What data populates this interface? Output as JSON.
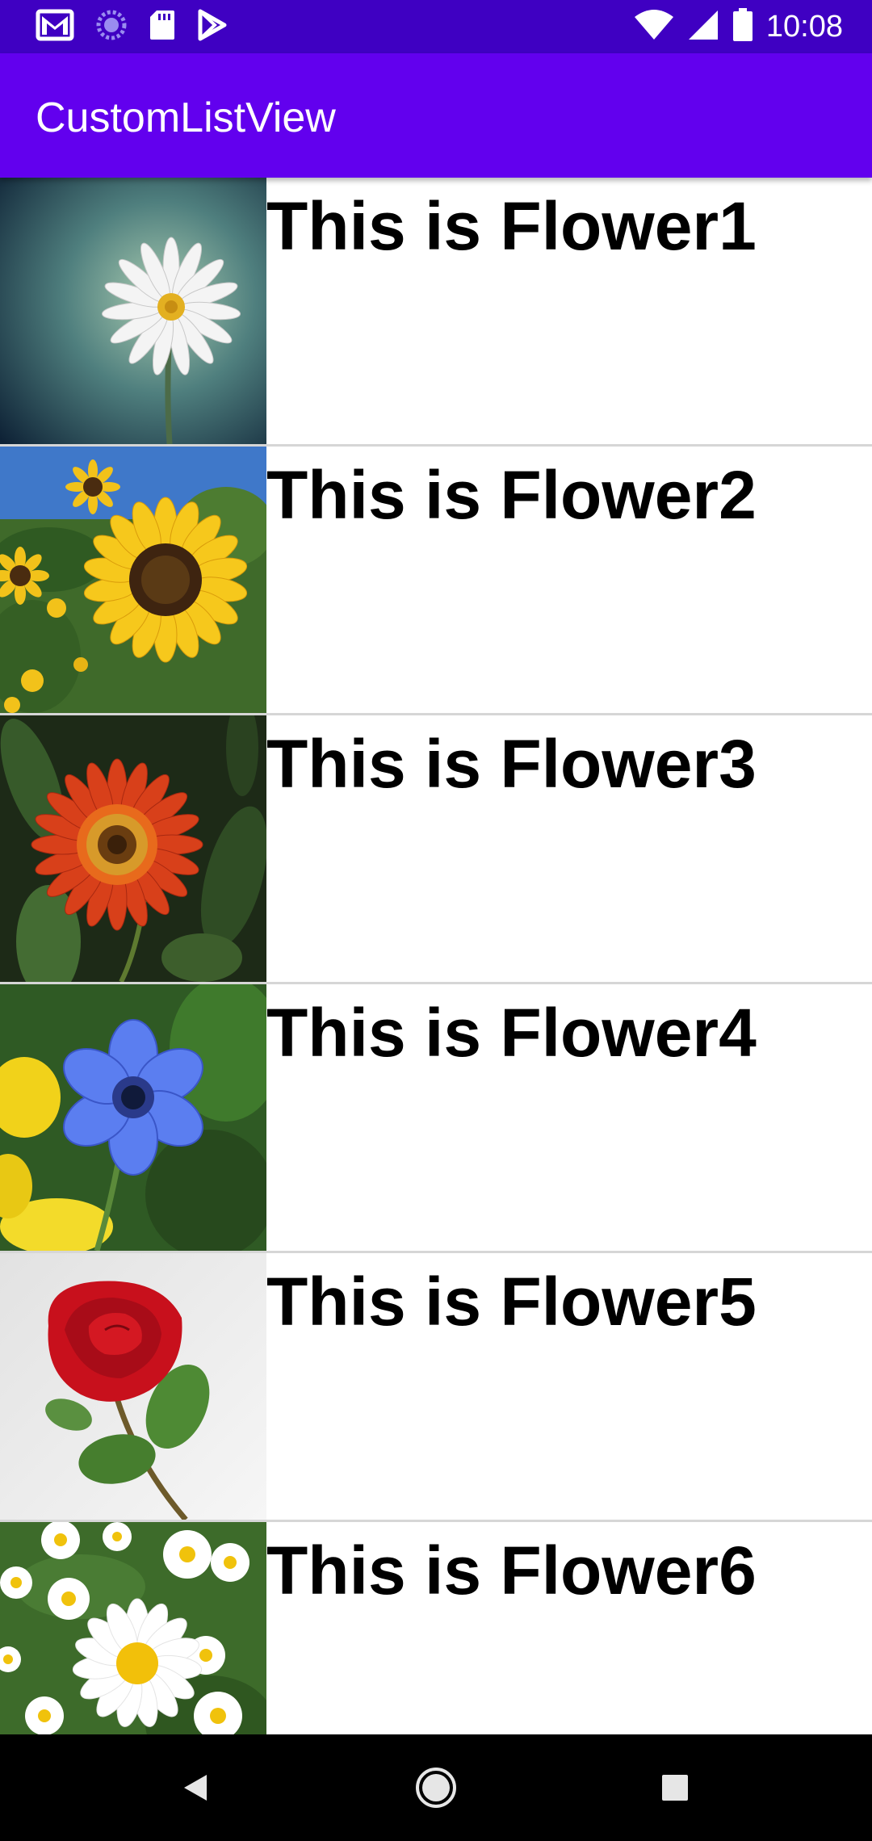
{
  "status_bar": {
    "time": "10:08",
    "left_icons": [
      "gmail-icon",
      "sync-icon",
      "sd-card-icon",
      "play-store-icon"
    ],
    "right_icons": [
      "wifi-icon",
      "cell-signal-icon",
      "battery-icon"
    ]
  },
  "app_bar": {
    "title": "CustomListView",
    "color": "#6200ee",
    "status_color": "#3f00c2"
  },
  "list": {
    "items": [
      {
        "label": "This is Flower1",
        "image": "white-daisy-image"
      },
      {
        "label": "This is Flower2",
        "image": "sunflower-image"
      },
      {
        "label": "This is Flower3",
        "image": "orange-gerbera-image"
      },
      {
        "label": "This is Flower4",
        "image": "blue-anemone-image"
      },
      {
        "label": "This is Flower5",
        "image": "red-rose-image"
      },
      {
        "label": "This is Flower6",
        "image": "daisy-field-image"
      }
    ]
  },
  "nav_bar": {
    "icons": [
      "back-icon",
      "home-icon",
      "recents-icon"
    ]
  }
}
